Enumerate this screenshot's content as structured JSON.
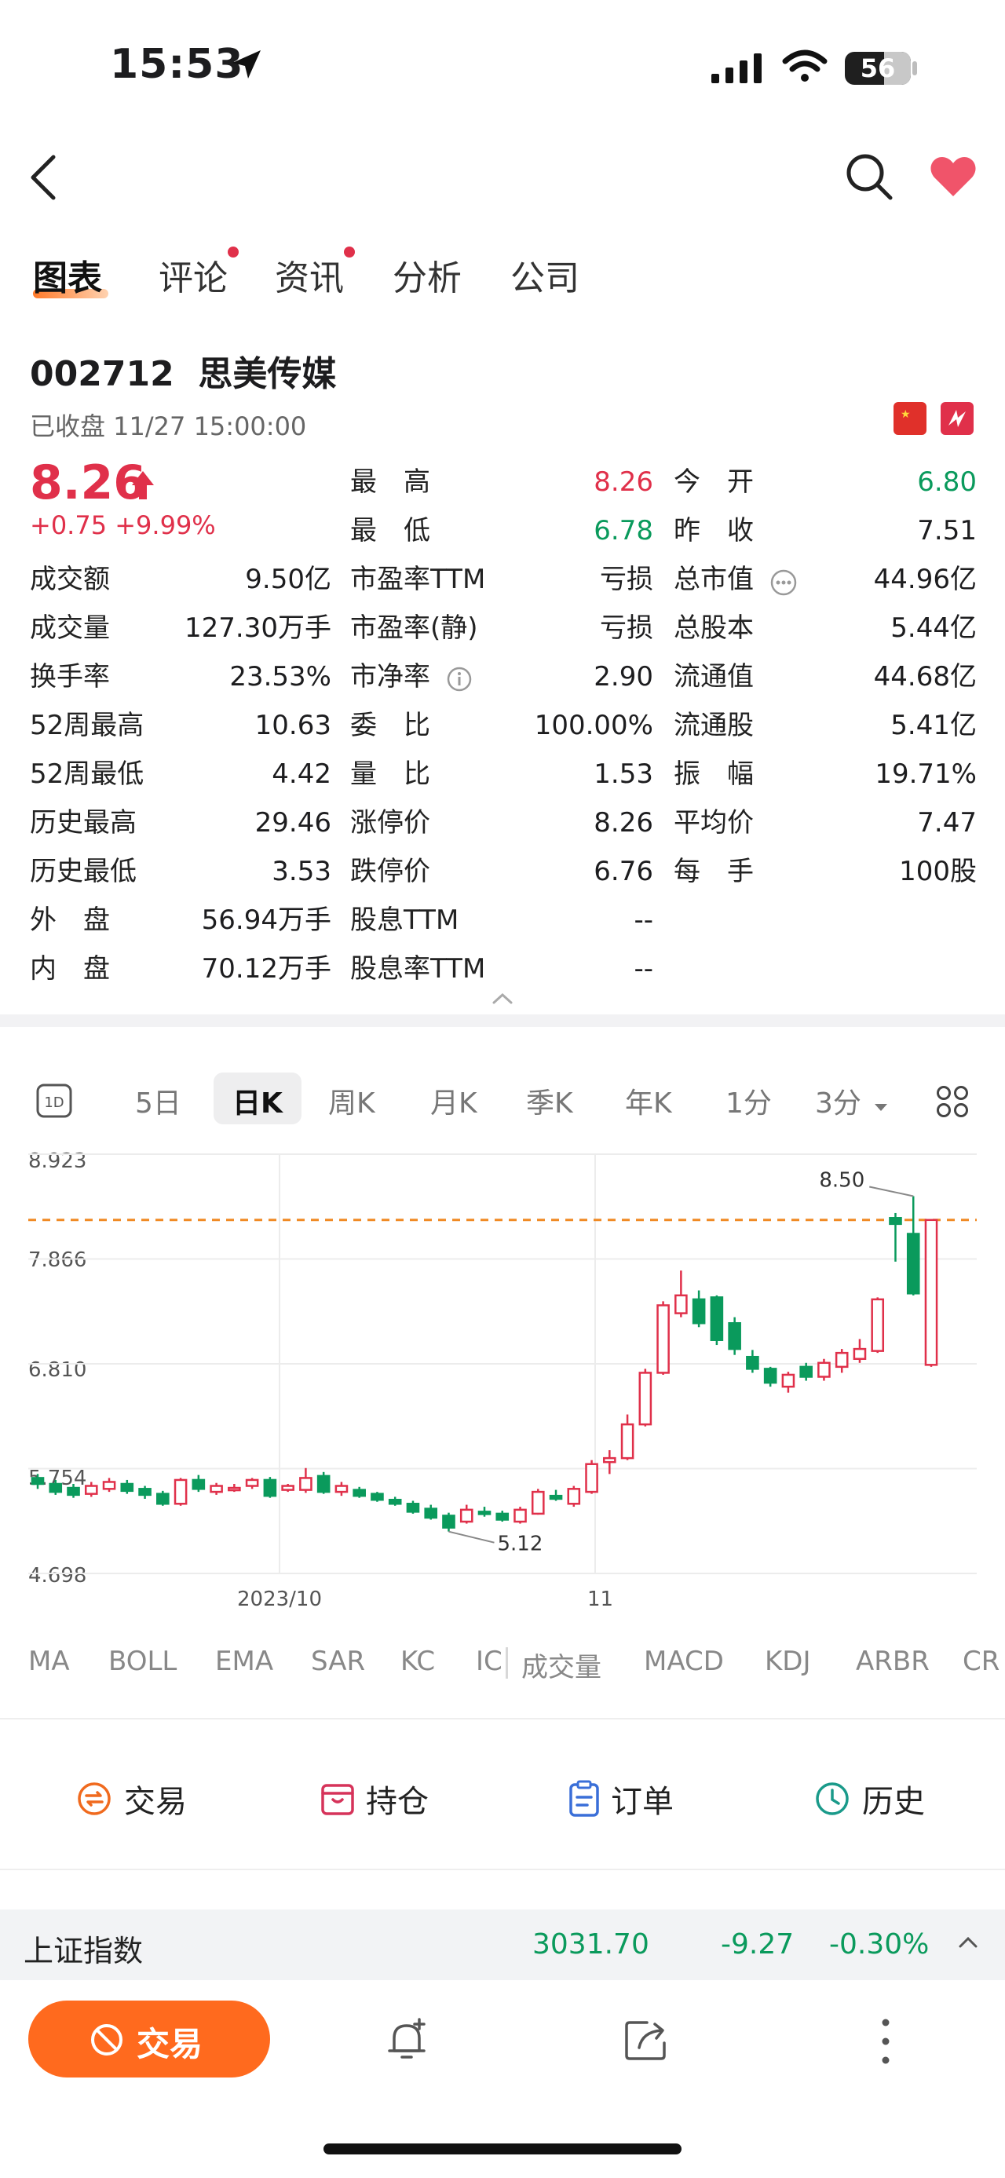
{
  "status_bar": {
    "time": "15:53",
    "battery": "56"
  },
  "tabs": [
    {
      "label": "图表",
      "active": true,
      "dot": false
    },
    {
      "label": "评论",
      "active": false,
      "dot": true
    },
    {
      "label": "资讯",
      "active": false,
      "dot": true
    },
    {
      "label": "分析",
      "active": false,
      "dot": false
    },
    {
      "label": "公司",
      "active": false,
      "dot": false
    }
  ],
  "stock": {
    "code": "002712",
    "name": "思美传媒",
    "status_time": "已收盘 11/27 15:00:00",
    "price": "8.26",
    "change": "+0.75",
    "change_pct": "+9.99%"
  },
  "quote_middle": [
    {
      "label": "最　高",
      "value": "8.26",
      "color": "red"
    },
    {
      "label": "最　低",
      "value": "6.78",
      "color": "green"
    }
  ],
  "quote_right_top": [
    {
      "label": "今　开",
      "value": "6.80",
      "color": "green"
    },
    {
      "label": "昨　收",
      "value": "7.51",
      "color": "black"
    }
  ],
  "stats": [
    [
      "成交额",
      "9.50亿",
      "市盈率TTM",
      "亏损",
      "总市值",
      "44.96亿"
    ],
    [
      "成交量",
      "127.30万手",
      "市盈率(静)",
      "亏损",
      "总股本",
      "5.44亿"
    ],
    [
      "换手率",
      "23.53%",
      "市净率",
      "2.90",
      "流通值",
      "44.68亿"
    ],
    [
      "52周最高",
      "10.63",
      "委　比",
      "100.00%",
      "流通股",
      "5.41亿"
    ],
    [
      "52周最低",
      "4.42",
      "量　比",
      "1.53",
      "振　幅",
      "19.71%"
    ],
    [
      "历史最高",
      "29.46",
      "涨停价",
      "8.26",
      "平均价",
      "7.47"
    ],
    [
      "历史最低",
      "3.53",
      "跌停价",
      "6.76",
      "每　手",
      "100股"
    ],
    [
      "外　盘",
      "56.94万手",
      "股息TTM",
      "--",
      "",
      ""
    ],
    [
      "内　盘",
      "70.12万手",
      "股息率TTM",
      "--",
      "",
      ""
    ]
  ],
  "period_tabs": [
    "5日",
    "日K",
    "周K",
    "月K",
    "季K",
    "年K",
    "1分",
    "3分"
  ],
  "period_icon_label": "1D",
  "active_period": "日K",
  "chart_data": {
    "type": "candlestick",
    "y_ticks": [
      "8.923",
      "7.866",
      "6.810",
      "5.754",
      "4.698"
    ],
    "ylim": [
      4.698,
      8.923
    ],
    "x_ticks": [
      "2023/10",
      "11"
    ],
    "reference_price": 8.26,
    "annotations": [
      {
        "label": "8.50",
        "value": 8.5
      },
      {
        "label": "5.12",
        "value": 5.12
      }
    ],
    "candles": [
      {
        "o": 5.66,
        "c": 5.6,
        "h": 5.7,
        "l": 5.55
      },
      {
        "o": 5.6,
        "c": 5.52,
        "h": 5.64,
        "l": 5.49
      },
      {
        "o": 5.56,
        "c": 5.49,
        "h": 5.6,
        "l": 5.46
      },
      {
        "o": 5.5,
        "c": 5.58,
        "h": 5.62,
        "l": 5.47
      },
      {
        "o": 5.55,
        "c": 5.62,
        "h": 5.66,
        "l": 5.52
      },
      {
        "o": 5.6,
        "c": 5.53,
        "h": 5.64,
        "l": 5.5
      },
      {
        "o": 5.55,
        "c": 5.49,
        "h": 5.58,
        "l": 5.45
      },
      {
        "o": 5.5,
        "c": 5.4,
        "h": 5.53,
        "l": 5.38
      },
      {
        "o": 5.4,
        "c": 5.64,
        "h": 5.66,
        "l": 5.38
      },
      {
        "o": 5.64,
        "c": 5.55,
        "h": 5.69,
        "l": 5.52
      },
      {
        "o": 5.52,
        "c": 5.58,
        "h": 5.61,
        "l": 5.49
      },
      {
        "o": 5.54,
        "c": 5.56,
        "h": 5.6,
        "l": 5.52
      },
      {
        "o": 5.58,
        "c": 5.64,
        "h": 5.66,
        "l": 5.55
      },
      {
        "o": 5.64,
        "c": 5.48,
        "h": 5.67,
        "l": 5.46
      },
      {
        "o": 5.54,
        "c": 5.58,
        "h": 5.6,
        "l": 5.52
      },
      {
        "o": 5.54,
        "c": 5.66,
        "h": 5.76,
        "l": 5.51
      },
      {
        "o": 5.68,
        "c": 5.52,
        "h": 5.72,
        "l": 5.5
      },
      {
        "o": 5.52,
        "c": 5.58,
        "h": 5.62,
        "l": 5.48
      },
      {
        "o": 5.54,
        "c": 5.48,
        "h": 5.57,
        "l": 5.46
      },
      {
        "o": 5.5,
        "c": 5.44,
        "h": 5.52,
        "l": 5.42
      },
      {
        "o": 5.44,
        "c": 5.4,
        "h": 5.47,
        "l": 5.38
      },
      {
        "o": 5.4,
        "c": 5.32,
        "h": 5.43,
        "l": 5.3
      },
      {
        "o": 5.35,
        "c": 5.26,
        "h": 5.39,
        "l": 5.24
      },
      {
        "o": 5.28,
        "c": 5.16,
        "h": 5.31,
        "l": 5.12
      },
      {
        "o": 5.22,
        "c": 5.34,
        "h": 5.39,
        "l": 5.2
      },
      {
        "o": 5.32,
        "c": 5.3,
        "h": 5.37,
        "l": 5.27
      },
      {
        "o": 5.3,
        "c": 5.24,
        "h": 5.33,
        "l": 5.22
      },
      {
        "o": 5.22,
        "c": 5.34,
        "h": 5.37,
        "l": 5.2
      },
      {
        "o": 5.3,
        "c": 5.52,
        "h": 5.55,
        "l": 5.29
      },
      {
        "o": 5.48,
        "c": 5.45,
        "h": 5.54,
        "l": 5.43
      },
      {
        "o": 5.4,
        "c": 5.55,
        "h": 5.58,
        "l": 5.37
      },
      {
        "o": 5.52,
        "c": 5.8,
        "h": 5.84,
        "l": 5.5
      },
      {
        "o": 5.82,
        "c": 5.86,
        "h": 5.94,
        "l": 5.7
      },
      {
        "o": 5.86,
        "c": 6.2,
        "h": 6.3,
        "l": 5.84
      },
      {
        "o": 6.2,
        "c": 6.72,
        "h": 6.76,
        "l": 6.18
      },
      {
        "o": 6.72,
        "c": 7.4,
        "h": 7.44,
        "l": 6.7
      },
      {
        "o": 7.32,
        "c": 7.5,
        "h": 7.75,
        "l": 7.28
      },
      {
        "o": 7.46,
        "c": 7.22,
        "h": 7.55,
        "l": 7.18
      },
      {
        "o": 7.48,
        "c": 7.05,
        "h": 7.5,
        "l": 7.0
      },
      {
        "o": 7.22,
        "c": 6.96,
        "h": 7.28,
        "l": 6.9
      },
      {
        "o": 6.88,
        "c": 6.76,
        "h": 6.95,
        "l": 6.72
      },
      {
        "o": 6.76,
        "c": 6.62,
        "h": 6.78,
        "l": 6.58
      },
      {
        "o": 6.58,
        "c": 6.7,
        "h": 6.73,
        "l": 6.52
      },
      {
        "o": 6.78,
        "c": 6.68,
        "h": 6.82,
        "l": 6.64
      },
      {
        "o": 6.68,
        "c": 6.82,
        "h": 6.86,
        "l": 6.64
      },
      {
        "o": 6.78,
        "c": 6.92,
        "h": 6.96,
        "l": 6.72
      },
      {
        "o": 6.86,
        "c": 6.96,
        "h": 7.06,
        "l": 6.82
      },
      {
        "o": 6.94,
        "c": 7.46,
        "h": 7.48,
        "l": 6.92
      },
      {
        "o": 8.28,
        "c": 8.22,
        "h": 8.33,
        "l": 7.84
      },
      {
        "o": 8.12,
        "c": 7.52,
        "h": 8.5,
        "l": 7.5
      },
      {
        "o": 6.8,
        "c": 8.26,
        "h": 8.26,
        "l": 6.78
      }
    ]
  },
  "indicators": [
    "MA",
    "BOLL",
    "EMA",
    "SAR",
    "KC",
    "IC",
    "成交量",
    "MACD",
    "KDJ",
    "ARBR",
    "CR"
  ],
  "actions": [
    {
      "label": "交易",
      "icon": "trade-icon",
      "color": "#f06a1e"
    },
    {
      "label": "持仓",
      "icon": "position-icon",
      "color": "#d6335a"
    },
    {
      "label": "订单",
      "icon": "order-icon",
      "color": "#3a6fd8"
    },
    {
      "label": "历史",
      "icon": "history-icon",
      "color": "#1a9a8a"
    }
  ],
  "index_bar": {
    "name": "上证指数",
    "value": "3031.70",
    "change": "-9.27",
    "change_pct": "-0.30%"
  },
  "bottom_bar": {
    "trade_label": "交易"
  },
  "colors": {
    "up": "#e0304a",
    "down": "#0a9a5c",
    "accent": "#ff6a1e",
    "ref_line": "#f08a24"
  }
}
